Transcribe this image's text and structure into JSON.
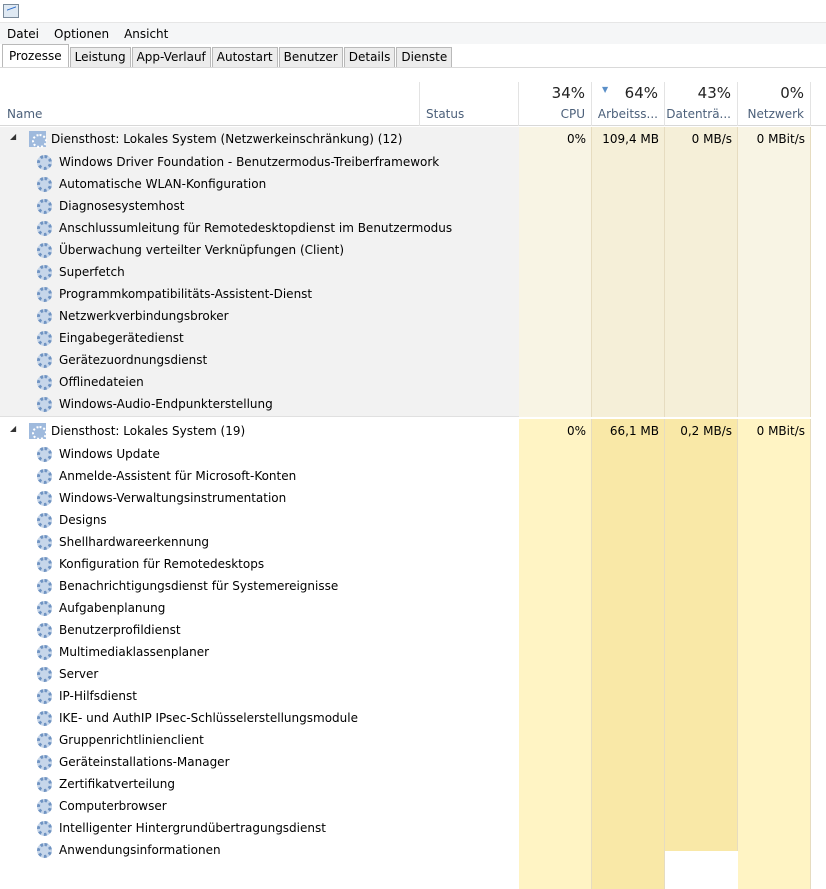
{
  "menu": [
    "Datei",
    "Optionen",
    "Ansicht"
  ],
  "tabs": [
    "Prozesse",
    "Leistung",
    "App-Verlauf",
    "Autostart",
    "Benutzer",
    "Details",
    "Dienste"
  ],
  "columns": {
    "name": "Name",
    "status": "Status",
    "cpu": {
      "pct": "34%",
      "label": "CPU"
    },
    "mem": {
      "pct": "64%",
      "label": "Arbeitss..."
    },
    "disk": {
      "pct": "43%",
      "label": "Datenträ..."
    },
    "net": {
      "pct": "0%",
      "label": "Netzwerk"
    }
  },
  "colors": {
    "group1_bg": "#f2f2f2",
    "cpu_light": "#f8f4e4",
    "mem_light": "#f5efd8",
    "cpu_yellow": "#fff4c4",
    "mem_yellow": "#f9e8a7"
  },
  "groups": [
    {
      "title": "Diensthost: Lokales System (Netzwerkeinschränkung) (12)",
      "cpu": "0%",
      "mem": "109,4 MB",
      "disk": "0 MB/s",
      "net": "0 MBit/s",
      "items": [
        "Windows Driver Foundation - Benutzermodus-Treiberframework",
        "Automatische WLAN-Konfiguration",
        "Diagnosesystemhost",
        "Anschlussumleitung für Remotedesktopdienst im Benutzermodus",
        "Überwachung verteilter Verknüpfungen (Client)",
        "Superfetch",
        "Programmkompatibilitäts-Assistent-Dienst",
        "Netzwerkverbindungsbroker",
        "Eingabegerätedienst",
        "Gerätezuordnungsdienst",
        "Offlinedateien",
        "Windows-Audio-Endpunkterstellung"
      ]
    },
    {
      "title": "Diensthost: Lokales System (19)",
      "cpu": "0%",
      "mem": "66,1 MB",
      "disk": "0,2 MB/s",
      "net": "0 MBit/s",
      "items": [
        "Windows Update",
        "Anmelde-Assistent für Microsoft-Konten",
        "Windows-Verwaltungsinstrumentation",
        "Designs",
        "Shellhardwareerkennung",
        "Konfiguration für Remotedesktops",
        "Benachrichtigungsdienst für Systemereignisse",
        "Aufgabenplanung",
        "Benutzerprofildienst",
        "Multimediaklassenplaner",
        "Server",
        "IP-Hilfsdienst",
        "IKE- und AuthIP IPsec-Schlüsselerstellungsmodule",
        "Gruppenrichtlinienclient",
        "Geräteinstallations-Manager",
        "Zertifikatverteilung",
        "Computerbrowser",
        "Intelligenter Hintergrundübertragungsdienst",
        "Anwendungsinformationen"
      ]
    }
  ]
}
